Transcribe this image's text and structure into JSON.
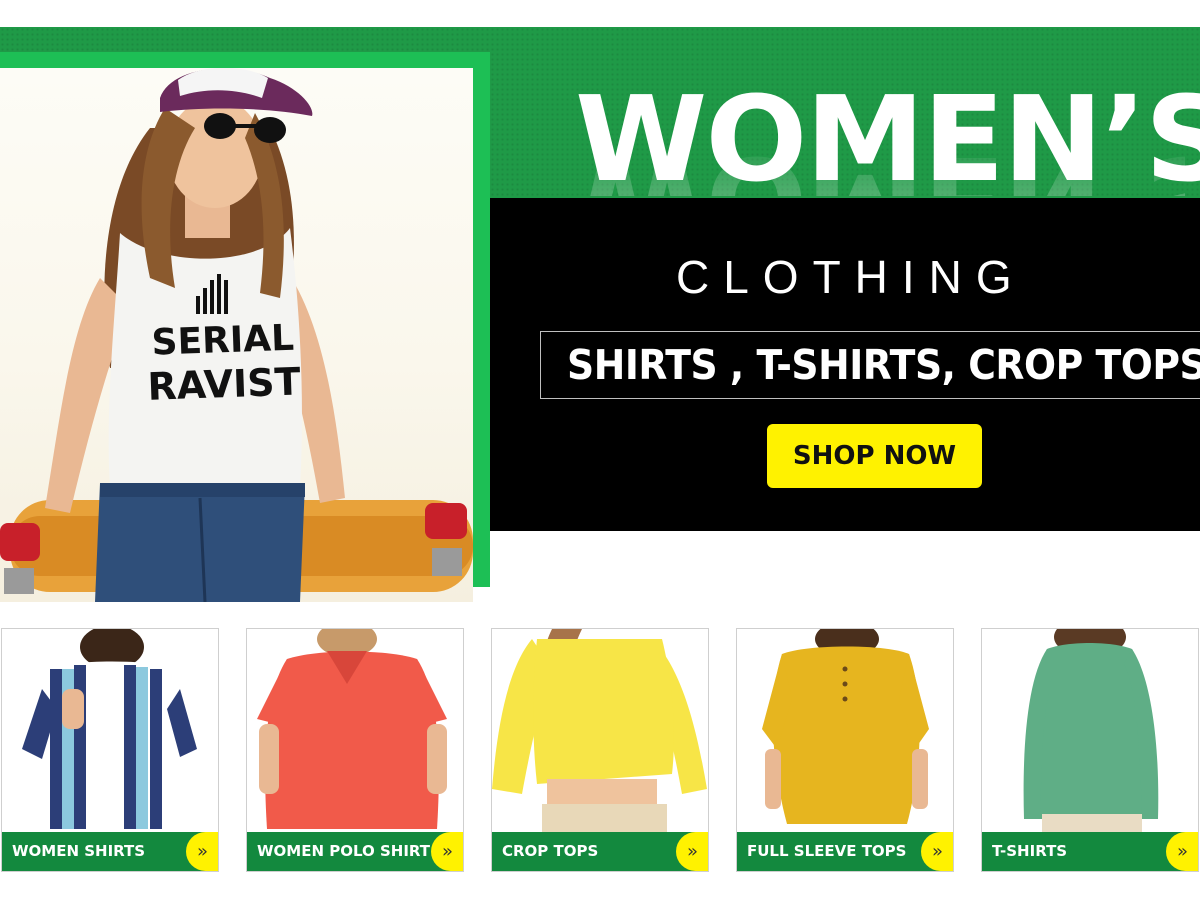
{
  "hero": {
    "headline": "WOMEN’S",
    "subheadline": "CLOTHING",
    "categories": "SHIRTS , T-SHIRTS, CROP TOPS",
    "cta_label": "SHOP NOW",
    "shirt_print_line1": "SERIAL",
    "shirt_print_line2": "RAVIST"
  },
  "products": [
    {
      "label": "WOMEN SHIRTS",
      "arrow": "»",
      "color": "#2c3e78"
    },
    {
      "label": "WOMEN POLO SHIRT",
      "arrow": "»",
      "color": "#f15a4a"
    },
    {
      "label": "CROP TOPS",
      "arrow": "»",
      "color": "#f7e547"
    },
    {
      "label": "FULL SLEEVE TOPS",
      "arrow": "»",
      "color": "#e6b51f"
    },
    {
      "label": "T-SHIRTS",
      "arrow": "»",
      "color": "#5fae86"
    }
  ],
  "colors": {
    "brand_green": "#1f9a47",
    "frame_green": "#1dbf55",
    "label_green": "#13893e",
    "accent_yellow": "#fff200",
    "panel_black": "#000000"
  }
}
